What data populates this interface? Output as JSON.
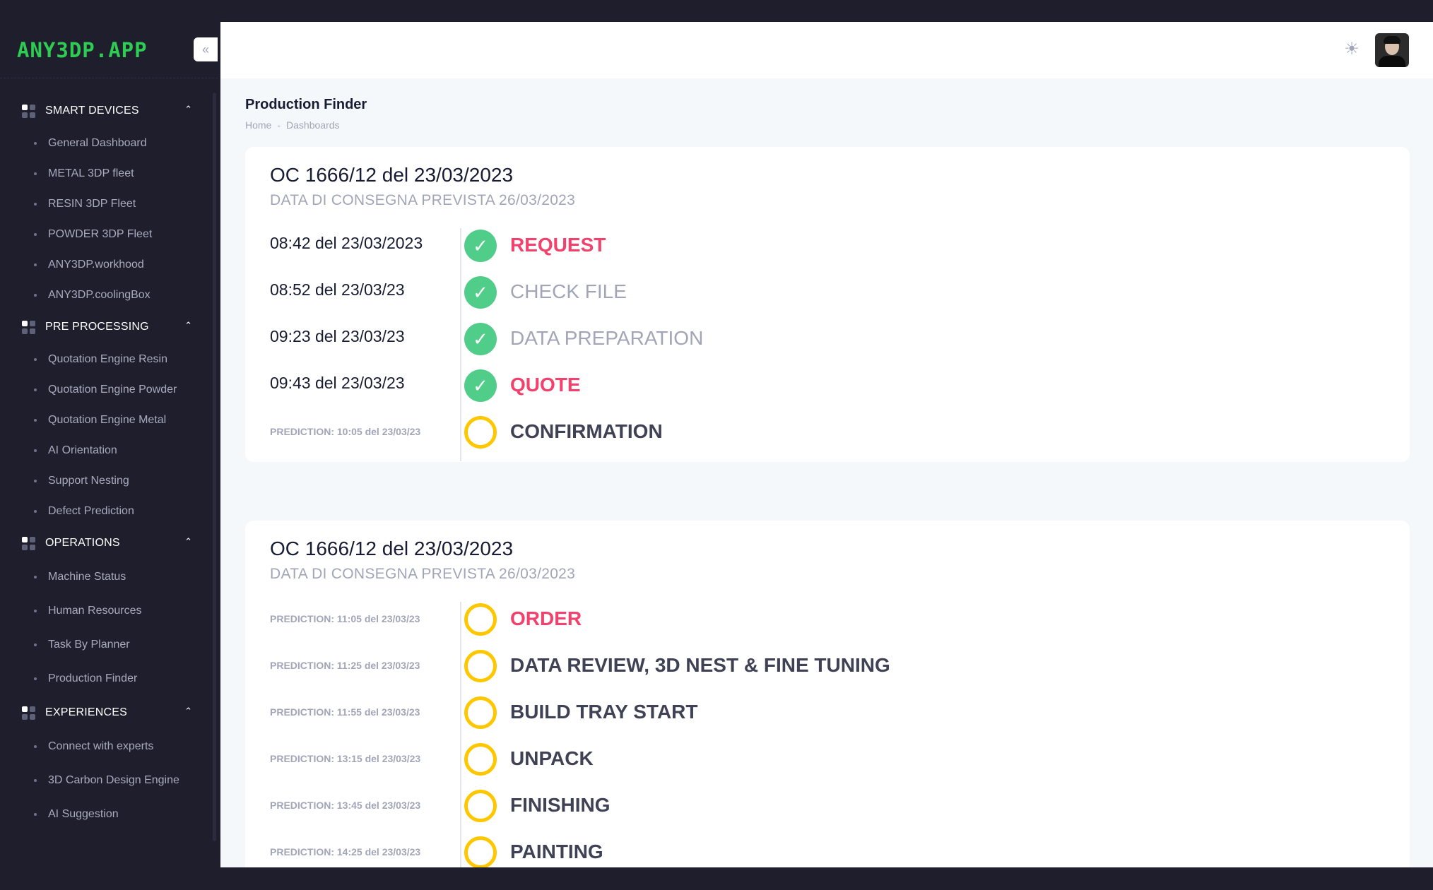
{
  "app": {
    "logo": "ANY3DP.APP",
    "collapse_icon": "«"
  },
  "sidebar": {
    "sections": [
      {
        "label": "SMART DEVICES",
        "items": [
          "General Dashboard",
          "METAL 3DP fleet",
          "RESIN 3DP Fleet",
          "POWDER 3DP Fleet",
          "ANY3DP.workhood",
          "ANY3DP.coolingBox"
        ]
      },
      {
        "label": "PRE PROCESSING",
        "items": [
          "Quotation Engine Resin",
          "Quotation Engine Powder",
          "Quotation Engine Metal",
          "AI Orientation",
          "Support Nesting",
          "Defect Prediction"
        ]
      },
      {
        "label": "OPERATIONS",
        "items": [
          "Machine Status",
          "Human Resources",
          "Task By Planner",
          "Production Finder"
        ]
      },
      {
        "label": "EXPERIENCES",
        "items": [
          "Connect with experts",
          "3D Carbon Design Engine",
          "AI Suggestion"
        ]
      }
    ]
  },
  "header": {
    "theme_icon": "☀"
  },
  "page": {
    "title": "Production Finder",
    "breadcrumb": [
      "Home",
      "-",
      "Dashboards"
    ]
  },
  "orders": [
    {
      "title": "OC 1666/12 del 23/03/2023",
      "delivery": "DATA DI CONSEGNA PREVISTA 26/03/2023",
      "steps": [
        {
          "time": "08:42 del 23/03/2023",
          "label": "REQUEST",
          "done": true,
          "tone": "pink"
        },
        {
          "time": "08:52 del 23/03/23",
          "label": "CHECK FILE",
          "done": true,
          "tone": "gray"
        },
        {
          "time": "09:23 del 23/03/23",
          "label": "DATA PREPARATION",
          "done": true,
          "tone": "gray"
        },
        {
          "time": "09:43 del 23/03/23",
          "label": "QUOTE",
          "done": true,
          "tone": "pink"
        },
        {
          "time": "PREDICTION: 10:05 del 23/03/23",
          "label": "CONFIRMATION",
          "done": false,
          "tone": "dark"
        }
      ]
    },
    {
      "title": "OC 1666/12 del 23/03/2023",
      "delivery": "DATA DI CONSEGNA PREVISTA 26/03/2023",
      "steps": [
        {
          "time": "PREDICTION: 11:05 del 23/03/23",
          "label": "ORDER",
          "done": false,
          "tone": "pink"
        },
        {
          "time": "PREDICTION: 11:25 del 23/03/23",
          "label": "DATA REVIEW, 3D NEST & FINE TUNING",
          "done": false,
          "tone": "dark"
        },
        {
          "time": "PREDICTION: 11:55 del 23/03/23",
          "label": "BUILD TRAY START",
          "done": false,
          "tone": "dark"
        },
        {
          "time": "PREDICTION: 13:15 del 23/03/23",
          "label": "UNPACK",
          "done": false,
          "tone": "dark"
        },
        {
          "time": "PREDICTION: 13:45 del 23/03/23",
          "label": "FINISHING",
          "done": false,
          "tone": "dark"
        },
        {
          "time": "PREDICTION: 14:25 del 23/03/23",
          "label": "PAINTING",
          "done": false,
          "tone": "dark"
        }
      ]
    }
  ],
  "colors": {
    "accent_green": "#2ecc53",
    "success": "#50cd89",
    "pending": "#ffc700",
    "pink": "#f1416c"
  }
}
